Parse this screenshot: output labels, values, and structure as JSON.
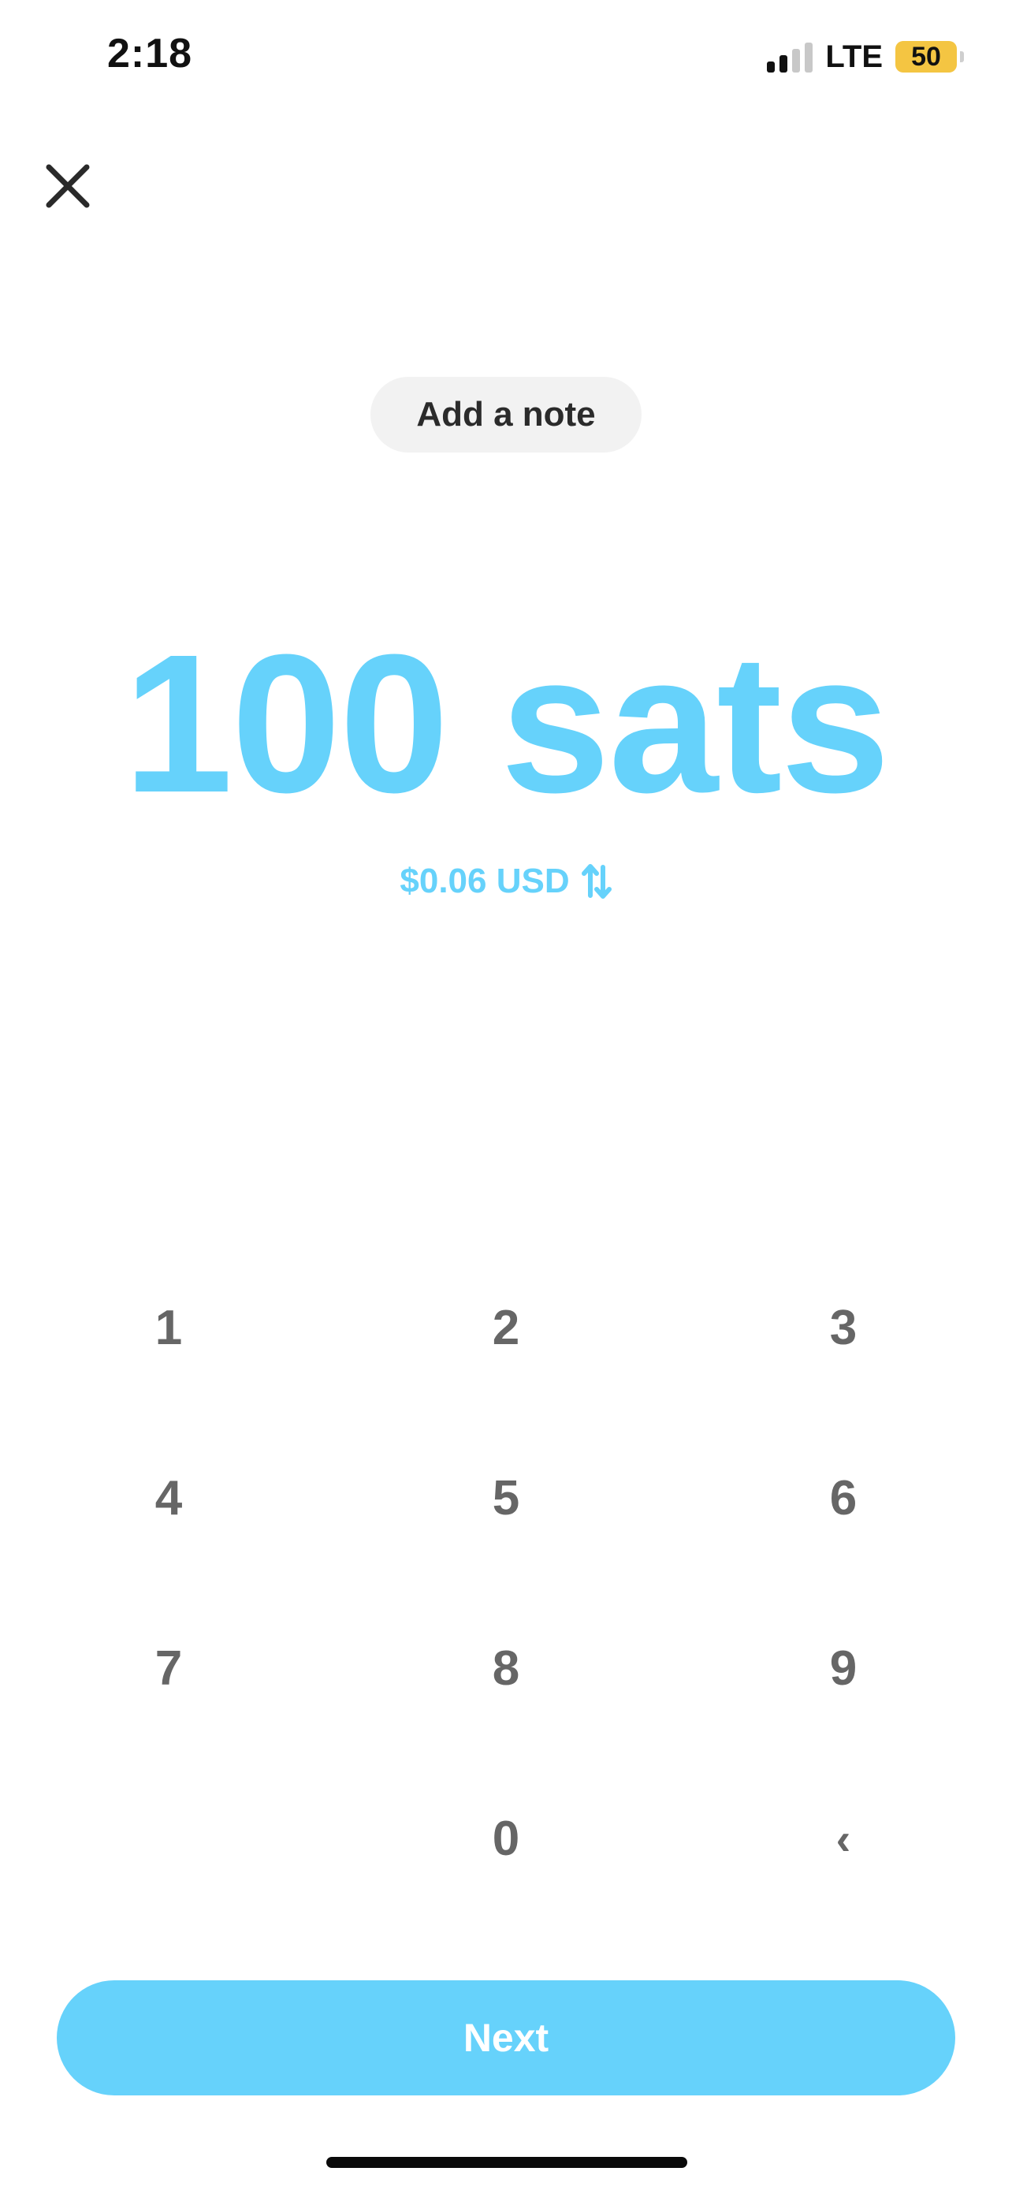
{
  "status_bar": {
    "time": "2:18",
    "network": "LTE",
    "battery_level": "50",
    "signal_bars_active": 2,
    "signal_bars_total": 4
  },
  "header": {
    "close_icon": "close-x-icon"
  },
  "note": {
    "label": "Add a note"
  },
  "amount": {
    "value": "100 sats"
  },
  "conversion": {
    "text": "$0.06 USD",
    "icon": "swap-arrows-icon"
  },
  "keypad": {
    "keys": [
      "1",
      "2",
      "3",
      "4",
      "5",
      "6",
      "7",
      "8",
      "9",
      "",
      "0",
      "‹"
    ]
  },
  "actions": {
    "next_label": "Next"
  },
  "colors": {
    "accent": "#66d2fb",
    "battery_fill": "#f4c542",
    "key_text": "#666666",
    "pill_bg": "#f2f2f2"
  }
}
